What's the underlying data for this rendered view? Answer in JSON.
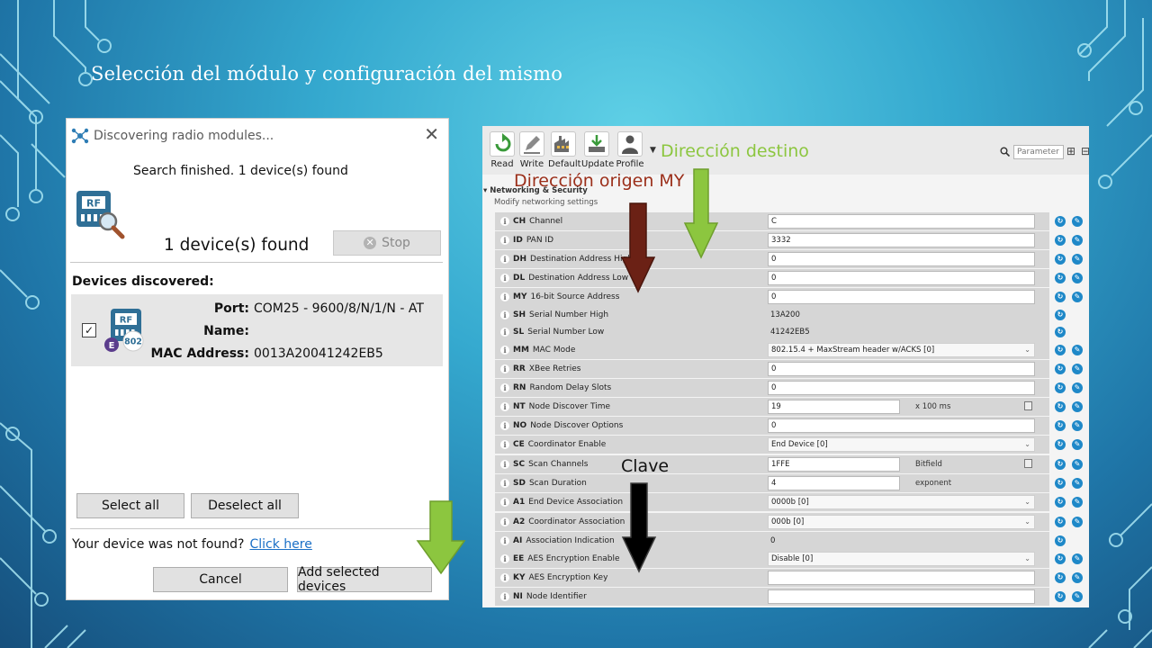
{
  "slide": {
    "title": "Selección del módulo y configuración del mismo"
  },
  "dialog": {
    "title": "Discovering radio modules...",
    "status": "Search finished. 1 device(s) found",
    "count_text": "1 device(s) found",
    "stop_label": "Stop",
    "section_title": "Devices discovered:",
    "device": {
      "checked": true,
      "port_label": "Port:",
      "port_value": "COM25 - 9600/8/N/1/N - AT",
      "name_label": "Name:",
      "name_value": "",
      "mac_label": "MAC Address:",
      "mac_value": "0013A20041242EB5",
      "icon_text": "RF",
      "badge_text": "802",
      "badge_letter": "E"
    },
    "select_all": "Select all",
    "deselect_all": "Deselect all",
    "not_found_text": "Your device was not found?",
    "click_here": "Click here",
    "cancel": "Cancel",
    "add_selected": "Add selected devices"
  },
  "xctu": {
    "toolbar": [
      {
        "label": "Read",
        "icon": "read-icon"
      },
      {
        "label": "Write",
        "icon": "write-icon"
      },
      {
        "label": "Default",
        "icon": "default-icon"
      },
      {
        "label": "Update",
        "icon": "update-icon"
      },
      {
        "label": "Profile",
        "icon": "profile-icon"
      }
    ],
    "search_placeholder": "Parameter",
    "section_title": "Networking & Security",
    "section_subtitle": "Modify networking settings",
    "params": [
      {
        "code": "CH",
        "name": "Channel",
        "kind": "input",
        "value": "C"
      },
      {
        "code": "ID",
        "name": "PAN ID",
        "kind": "input",
        "value": "3332"
      },
      {
        "code": "DH",
        "name": "Destination Address High",
        "kind": "input",
        "value": "0"
      },
      {
        "code": "DL",
        "name": "Destination Address Low",
        "kind": "input",
        "value": "0"
      },
      {
        "code": "MY",
        "name": "16-bit Source Address",
        "kind": "input",
        "value": "0"
      },
      {
        "code": "SH",
        "name": "Serial Number High",
        "kind": "text",
        "value": "13A200"
      },
      {
        "code": "SL",
        "name": "Serial Number Low",
        "kind": "text",
        "value": "41242EB5"
      },
      {
        "code": "MM",
        "name": "MAC Mode",
        "kind": "select",
        "value": "802.15.4 + MaxStream header w/ACKS [0]"
      },
      {
        "code": "RR",
        "name": "XBee Retries",
        "kind": "input",
        "value": "0"
      },
      {
        "code": "RN",
        "name": "Random Delay Slots",
        "kind": "input",
        "value": "0"
      },
      {
        "code": "NT",
        "name": "Node Discover Time",
        "kind": "short",
        "value": "19",
        "suffix": "x 100 ms",
        "calc": true
      },
      {
        "code": "NO",
        "name": "Node Discover Options",
        "kind": "input",
        "value": "0"
      },
      {
        "code": "CE",
        "name": "Coordinator Enable",
        "kind": "select",
        "value": "End Device [0]"
      },
      {
        "code": "SC",
        "name": "Scan Channels",
        "kind": "short",
        "value": "1FFE",
        "suffix": "Bitfield",
        "calc": true
      },
      {
        "code": "SD",
        "name": "Scan Duration",
        "kind": "short",
        "value": "4",
        "suffix": "exponent"
      },
      {
        "code": "A1",
        "name": "End Device Association",
        "kind": "select",
        "value": "0000b [0]"
      },
      {
        "code": "A2",
        "name": "Coordinator Association",
        "kind": "select",
        "value": "000b [0]"
      },
      {
        "code": "AI",
        "name": "Association Indication",
        "kind": "text",
        "value": "0"
      },
      {
        "code": "EE",
        "name": "AES Encryption Enable",
        "kind": "select",
        "value": "Disable [0]"
      },
      {
        "code": "KY",
        "name": "AES Encryption Key",
        "kind": "input",
        "value": ""
      },
      {
        "code": "NI",
        "name": "Node Identifier",
        "kind": "input",
        "value": ""
      }
    ]
  },
  "annotations": {
    "destino": "Dirección destino",
    "origen": "Dirección origen MY",
    "clave": "Clave"
  },
  "colors": {
    "annotation_green": "#8cc63f",
    "annotation_red": "#9b2f1a",
    "arrow_red": "#6b2115",
    "refresh_icon": "#1e88c8"
  }
}
